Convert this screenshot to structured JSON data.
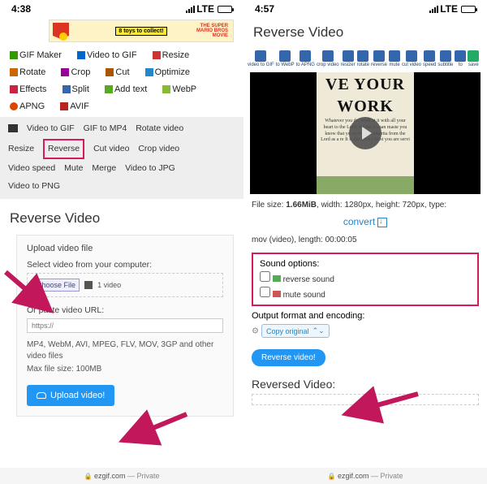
{
  "left": {
    "status": {
      "time": "4:38",
      "net": "LTE"
    },
    "banner_text": "8 toys to collect!",
    "banner_brand1": "THE SUPER",
    "banner_brand2": "MARIO BROS",
    "banner_brand3": "MOVIE",
    "tools": {
      "gifmaker": "GIF Maker",
      "v2gif": "Video to GIF",
      "resize": "Resize",
      "rotate": "Rotate",
      "crop": "Crop",
      "cut": "Cut",
      "optimize": "Optimize",
      "effects": "Effects",
      "split": "Split",
      "addtext": "Add text",
      "webp": "WebP",
      "apng": "APNG",
      "avif": "AVIF"
    },
    "subtabs": {
      "v2gif": "Video to GIF",
      "gif2mp4": "GIF to MP4",
      "rotvid": "Rotate video",
      "resize": "Resize",
      "reverse": "Reverse",
      "cutvid": "Cut video",
      "cropvid": "Crop video",
      "speed": "Video speed",
      "mute": "Mute",
      "merge": "Merge",
      "v2jpg": "Video to JPG",
      "v2png": "Video to PNG"
    },
    "title": "Reverse Video",
    "panel": {
      "legend": "Upload video file",
      "select_label": "Select video from your computer:",
      "choose": "Choose File",
      "filelabel": "1 video",
      "or_paste": "Or paste video URL:",
      "url_ph": "https://",
      "hint1": "MP4, WebM, AVI, MPEG, FLV, MOV, 3GP and other video files",
      "hint2": "Max file size: 100MB",
      "upload": "Upload video!"
    },
    "addr": {
      "site": "ezgif.com",
      "mode": "— Private"
    }
  },
  "right": {
    "status": {
      "time": "4:57",
      "net": "LTE"
    },
    "title": "Reverse Video",
    "toolbar": [
      "video to GIF",
      "to WebP",
      "to APNG",
      "crop video",
      "resizer",
      "rotate",
      "reverse",
      "mute",
      "cut video",
      "speed",
      "subtitle",
      "to",
      "save"
    ],
    "poster": {
      "line1": "VE YOUR",
      "line2": "WORK",
      "small": "Whatever you do, work at it with all your heart to the Lord, for the human maste you know that yo receive an inherita from the Lord as a re It is the Lord Christ you are servi"
    },
    "meta1_a": "File size: ",
    "meta1_b": "1.66MiB",
    "meta1_c": ", width: 1280px, height: 720px, type:",
    "convert": "convert",
    "meta2": "mov (video), length: 00:00:05",
    "sound": {
      "legend": "Sound options:",
      "rev": "reverse sound",
      "mute": "mute sound"
    },
    "enc": {
      "legend": "Output format and encoding:",
      "opt": "Copy original"
    },
    "revbtn": "Reverse video!",
    "revhead": "Reversed Video:",
    "addr": {
      "site": "ezgif.com",
      "mode": "— Private"
    }
  }
}
